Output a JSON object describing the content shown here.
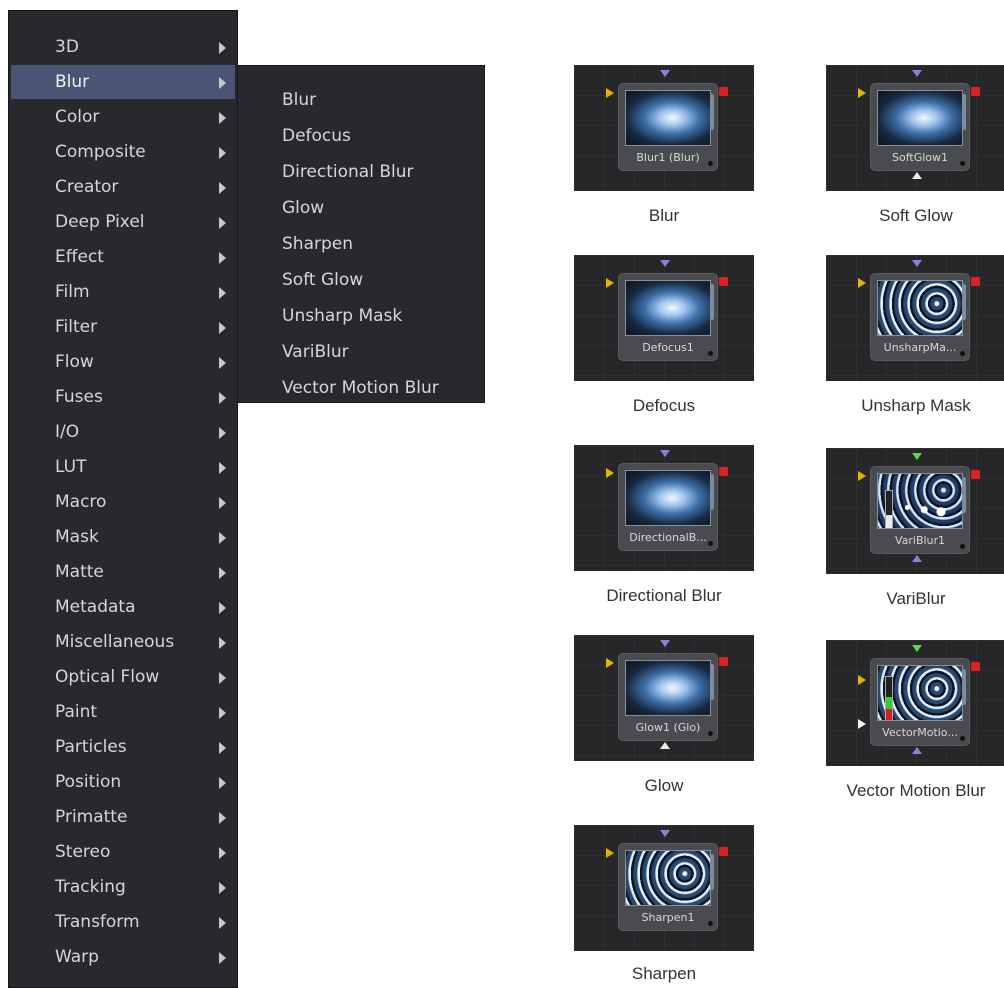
{
  "menu": {
    "items": [
      {
        "label": "3D"
      },
      {
        "label": "Blur"
      },
      {
        "label": "Color"
      },
      {
        "label": "Composite"
      },
      {
        "label": "Creator"
      },
      {
        "label": "Deep Pixel"
      },
      {
        "label": "Effect"
      },
      {
        "label": "Film"
      },
      {
        "label": "Filter"
      },
      {
        "label": "Flow"
      },
      {
        "label": "Fuses"
      },
      {
        "label": "I/O"
      },
      {
        "label": "LUT"
      },
      {
        "label": "Macro"
      },
      {
        "label": "Mask"
      },
      {
        "label": "Matte"
      },
      {
        "label": "Metadata"
      },
      {
        "label": "Miscellaneous"
      },
      {
        "label": "Optical Flow"
      },
      {
        "label": "Paint"
      },
      {
        "label": "Particles"
      },
      {
        "label": "Position"
      },
      {
        "label": "Primatte"
      },
      {
        "label": "Stereo"
      },
      {
        "label": "Tracking"
      },
      {
        "label": "Transform"
      },
      {
        "label": "Warp"
      }
    ],
    "selected": "Blur"
  },
  "submenu": {
    "items": [
      {
        "label": "Blur"
      },
      {
        "label": "Defocus"
      },
      {
        "label": "Directional Blur"
      },
      {
        "label": "Glow"
      },
      {
        "label": "Sharpen"
      },
      {
        "label": "Soft Glow"
      },
      {
        "label": "Unsharp Mask"
      },
      {
        "label": "VariBlur"
      },
      {
        "label": "Vector Motion Blur"
      }
    ]
  },
  "nodes": [
    {
      "node_label": "Blur1  (Blur)",
      "caption": "Blur"
    },
    {
      "node_label": "SoftGlow1",
      "caption": "Soft Glow"
    },
    {
      "node_label": "Defocus1",
      "caption": "Defocus"
    },
    {
      "node_label": "UnsharpMa...",
      "caption": "Unsharp Mask"
    },
    {
      "node_label": "DirectionalB...",
      "caption": "Directional Blur"
    },
    {
      "node_label": "VariBlur1",
      "caption": "VariBlur"
    },
    {
      "node_label": "Glow1  (Glo)",
      "caption": "Glow"
    },
    {
      "node_label": "VectorMotio...",
      "caption": "Vector Motion Blur"
    },
    {
      "node_label": "Sharpen1",
      "caption": "Sharpen"
    }
  ],
  "colors": {
    "menu_bg": "#27292d",
    "menu_selected": "#4a5575",
    "input_yellow": "#e6b400",
    "output_red": "#d92323",
    "mask_input": "#8b80d8",
    "green_input": "#5fd15a"
  }
}
